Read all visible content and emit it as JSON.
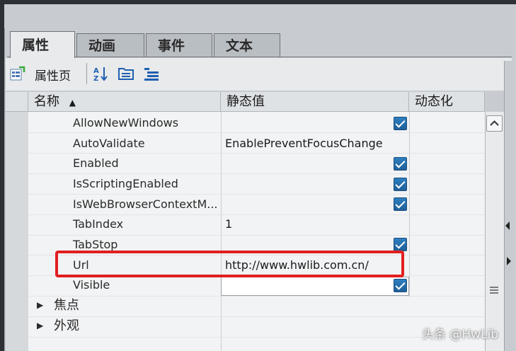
{
  "tabs": [
    {
      "label": "属性",
      "active": true
    },
    {
      "label": "动画",
      "active": false
    },
    {
      "label": "事件",
      "active": false
    },
    {
      "label": "文本",
      "active": false
    }
  ],
  "toolbar": {
    "property_page_label": "属性页",
    "icons": [
      "property-page-icon",
      "sort-az-icon",
      "folder-group-icon",
      "list-tree-icon"
    ]
  },
  "grid": {
    "headers": {
      "name": "名称",
      "static_value": "静态值",
      "dynamic": "动态化"
    },
    "rows": [
      {
        "name": "AllowNewWindows",
        "value": "",
        "checked": true
      },
      {
        "name": "AutoValidate",
        "value": "EnablePreventFocusChange",
        "checked": false
      },
      {
        "name": "Enabled",
        "value": "",
        "checked": true
      },
      {
        "name": "IsScriptingEnabled",
        "value": "",
        "checked": true
      },
      {
        "name": "IsWebBrowserContextM...",
        "value": "",
        "checked": true
      },
      {
        "name": "TabIndex",
        "value": "1",
        "checked": false
      },
      {
        "name": "TabStop",
        "value": "",
        "checked": true
      },
      {
        "name": "Url",
        "value": "http://www.hwlib.com.cn/",
        "checked": false
      },
      {
        "name": "Visible",
        "value": "",
        "checked": true
      }
    ],
    "groups": [
      {
        "name": "焦点"
      },
      {
        "name": "外观"
      }
    ]
  },
  "watermark": "头条 @HwLib",
  "colors": {
    "highlight": "#e21f1f",
    "checkbox": "#2d7fc0"
  }
}
